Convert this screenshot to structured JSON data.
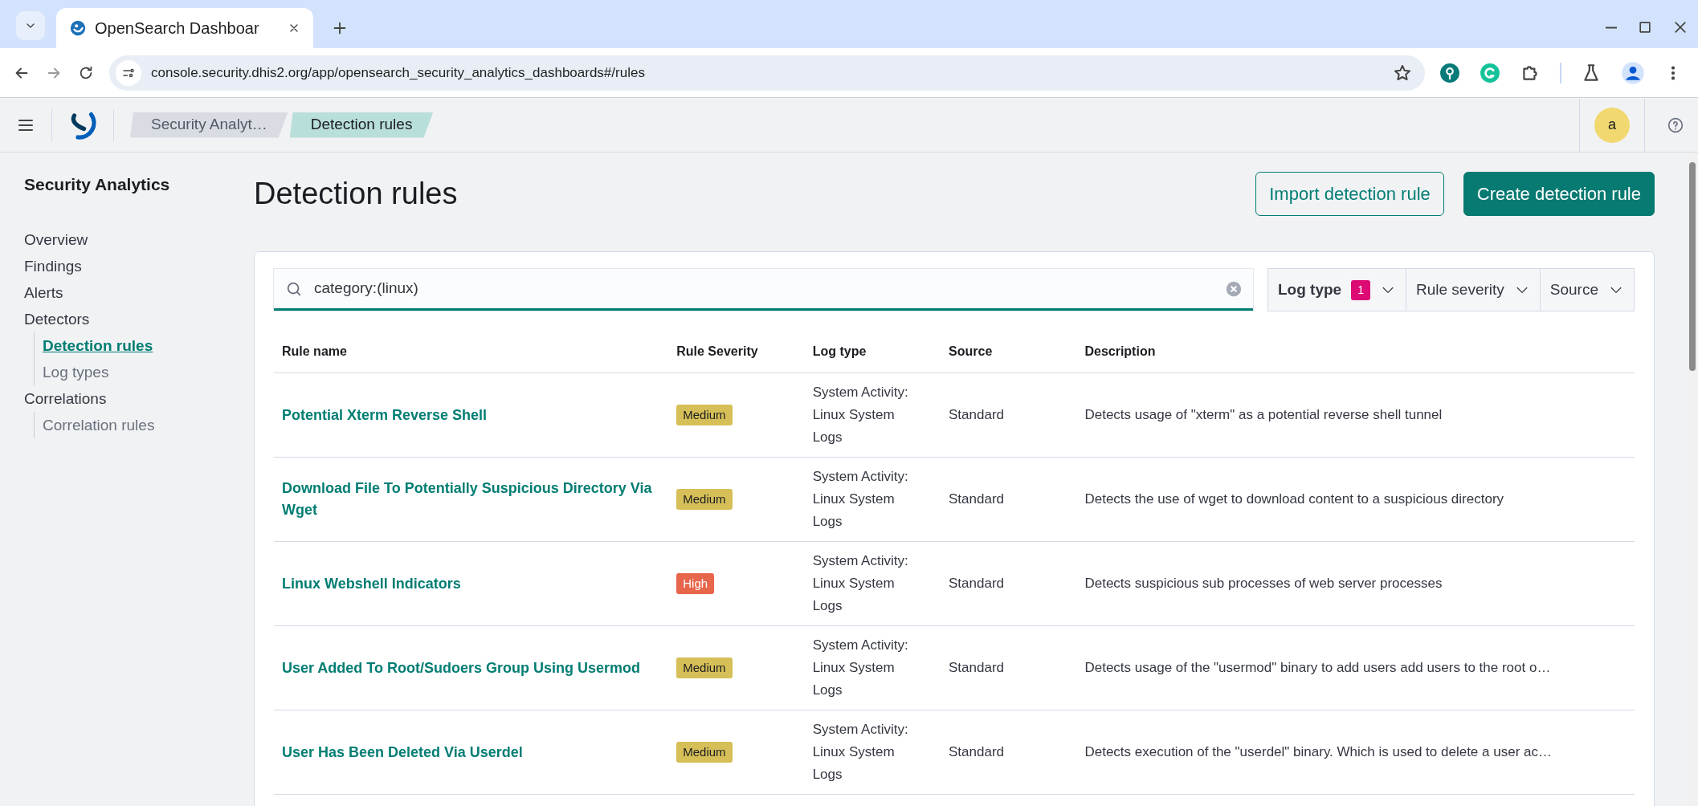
{
  "browser": {
    "tab_title": "OpenSearch Dashboar",
    "url": "console.security.dhis2.org/app/opensearch_security_analytics_dashboards#/rules"
  },
  "app_header": {
    "breadcrumbs": [
      {
        "label": "Security Analyt…",
        "selected": false
      },
      {
        "label": "Detection rules",
        "selected": true
      }
    ],
    "avatar": "a"
  },
  "sidebar": {
    "title": "Security Analytics",
    "items": [
      {
        "label": "Overview",
        "selected": false
      },
      {
        "label": "Findings",
        "selected": false
      },
      {
        "label": "Alerts",
        "selected": false
      },
      {
        "label": "Detectors",
        "selected": false,
        "children": [
          {
            "label": "Detection rules",
            "selected": true
          },
          {
            "label": "Log types",
            "selected": false
          }
        ]
      },
      {
        "label": "Correlations",
        "selected": false,
        "children": [
          {
            "label": "Correlation rules",
            "selected": false
          }
        ]
      }
    ]
  },
  "page": {
    "title": "Detection rules",
    "buttons": [
      {
        "label": "Import detection rule",
        "kind": "secondary"
      },
      {
        "label": "Create detection rule",
        "kind": "primary"
      }
    ]
  },
  "search": {
    "value": "category:(linux)"
  },
  "filters": [
    {
      "label": "Log type",
      "active": true,
      "count": "1"
    },
    {
      "label": "Rule severity",
      "active": false
    },
    {
      "label": "Source",
      "active": false
    }
  ],
  "table": {
    "columns": [
      "Rule name",
      "Rule Severity",
      "Log type",
      "Source",
      "Description"
    ],
    "rows": [
      {
        "name": "Potential Xterm Reverse Shell",
        "severity": "Medium",
        "color": "#d6bf57",
        "log_type": [
          "System Activity:",
          "Linux System",
          "Logs"
        ],
        "source": "Standard",
        "description": "Detects usage of \"xterm\" as a potential reverse shell tunnel"
      },
      {
        "name": "Download File To Potentially Suspicious Directory Via Wget",
        "severity": "Medium",
        "color": "#d6bf57",
        "log_type": [
          "System Activity:",
          "Linux System",
          "Logs"
        ],
        "source": "Standard",
        "description": "Detects the use of wget to download content to a suspicious directory"
      },
      {
        "name": "Linux Webshell Indicators",
        "severity": "High",
        "color": "#e7664c",
        "log_type": [
          "System Activity:",
          "Linux System",
          "Logs"
        ],
        "source": "Standard",
        "description": "Detects suspicious sub processes of web server processes"
      },
      {
        "name": "User Added To Root/Sudoers Group Using Usermod",
        "severity": "Medium",
        "color": "#d6bf57",
        "log_type": [
          "System Activity:",
          "Linux System",
          "Logs"
        ],
        "source": "Standard",
        "description": "Detects usage of the \"usermod\" binary to add users add users to the root o…"
      },
      {
        "name": "User Has Been Deleted Via Userdel",
        "severity": "Medium",
        "color": "#d6bf57",
        "log_type": [
          "System Activity:",
          "Linux System",
          "Logs"
        ],
        "source": "Standard",
        "description": "Detects execution of the \"userdel\" binary. Which is used to delete a user ac…"
      }
    ]
  }
}
